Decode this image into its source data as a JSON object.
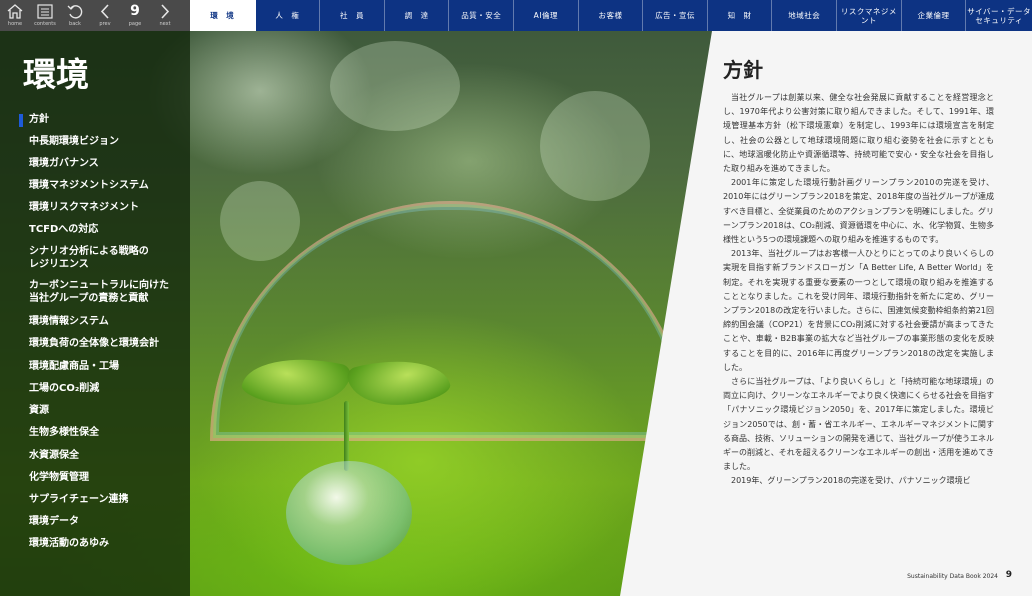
{
  "toolbar": {
    "home": "home",
    "contents": "contents",
    "back": "back",
    "prev": "prev",
    "page_number": "9",
    "page": "page",
    "next": "next"
  },
  "nav": {
    "tabs": [
      {
        "label": "環　境",
        "active": true
      },
      {
        "label": "人　権",
        "active": false
      },
      {
        "label": "社　員",
        "active": false
      },
      {
        "label": "調　達",
        "active": false
      },
      {
        "label": "品質・安全",
        "active": false
      },
      {
        "label": "AI倫理",
        "active": false
      },
      {
        "label": "お客様",
        "active": false
      },
      {
        "label": "広告・宣伝",
        "active": false
      },
      {
        "label": "知　財",
        "active": false
      },
      {
        "label": "地域社会",
        "active": false
      },
      {
        "label": "リスクマネジメント",
        "active": false
      },
      {
        "label": "企業倫理",
        "active": false
      },
      {
        "label": "サイバー・データ\nセキュリティ",
        "active": false
      }
    ]
  },
  "page_title": "環境",
  "sidebar": {
    "items": [
      {
        "label": "方針",
        "active": true
      },
      {
        "label": "中長期環境ビジョン"
      },
      {
        "label": "環境ガバナンス"
      },
      {
        "label": "環境マネジメントシステム"
      },
      {
        "label": "環境リスクマネジメント"
      },
      {
        "label": "TCFDへの対応"
      },
      {
        "label": "シナリオ分析による戦略の\nレジリエンス"
      },
      {
        "label": "カーボンニュートラルに向けた\n当社グループの責務と貢献"
      },
      {
        "label": "環境情報システム"
      },
      {
        "label": "環境負荷の全体像と環境会計"
      },
      {
        "label": "環境配慮商品・工場"
      },
      {
        "label": "工場のCO₂削減"
      },
      {
        "label": "資源"
      },
      {
        "label": "生物多様性保全"
      },
      {
        "label": "水資源保全"
      },
      {
        "label": "化学物質管理"
      },
      {
        "label": "サプライチェーン連携"
      },
      {
        "label": "環境データ"
      },
      {
        "label": "環境活動のあゆみ"
      }
    ]
  },
  "content": {
    "heading": "方針",
    "paragraphs": [
      "当社グループは創業以来、健全な社会発展に貢献することを経営理念とし、1970年代より公害対策に取り組んできました。そして、1991年、環境管理基本方針（松下環境憲章）を制定し、1993年には環境宣言を制定し、社会の公器として地球環境問題に取り組む姿勢を社会に示すとともに、地球温暖化防止や資源循環等、持続可能で安心・安全な社会を目指した取り組みを進めてきました。",
      "2001年に策定した環境行動計画グリーンプラン2010の完遂を受け、2010年にはグリーンプラン2018を策定、2018年度の当社グループが達成すべき目標と、全従業員のためのアクションプランを明確にしました。グリーンプラン2018は、CO₂削減、資源循環を中心に、水、化学物質、生物多様性という5つの環境課題への取り組みを推進するものです。",
      "2013年、当社グループはお客様一人ひとりにとってのより良いくらしの実現を目指す新ブランドスローガン「A Better Life, A Better World」を制定。それを実現する重要な要素の一つとして環境の取り組みを推進することとなりました。これを受け同年、環境行動指針を新たに定め、グリーンプラン2018の改定を行いました。さらに、国連気候変動枠組条約第21回締約国会議（COP21）を背景にCO₂削減に対する社会要請が高まってきたことや、車載・B2B事業の拡大など当社グループの事業形態の変化を反映することを目的に、2016年に再度グリーンプラン2018の改定を実施しました。",
      "さらに当社グループは、「より良いくらし」と「持続可能な地球環境」の両立に向け、クリーンなエネルギーでより良く快適にくらせる社会を目指す「パナソニック環境ビジョン2050」を、2017年に策定しました。環境ビジョン2050では、創・蓄・省エネルギー、エネルギーマネジメントに関する商品、技術、ソリューションの開発を通じて、当社グループが使うエネルギーの削減と、それを超えるクリーンなエネルギーの創出・活用を進めてきました。",
      "2019年、グリーンプラン2018の完遂を受け、パナソニック環境ビ"
    ]
  },
  "footer": {
    "book": "Sustainability Data Book 2024",
    "page": "9"
  },
  "colors": {
    "nav_bg": "#0d3383",
    "toolbar_bg": "#4a4a4a",
    "active_marker": "#1e5bd8"
  }
}
